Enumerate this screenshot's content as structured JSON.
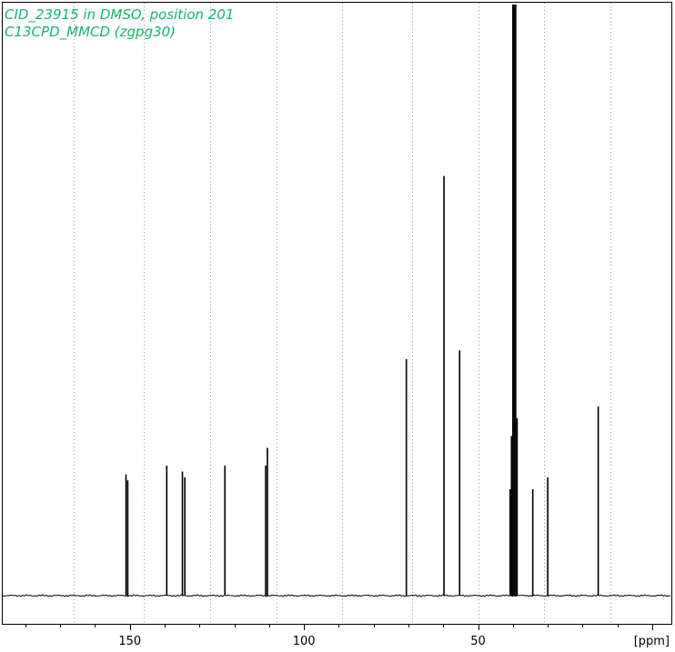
{
  "header": {
    "line1": "CID_23915 in DMSO, position 201",
    "line2": "C13CPD_MMCD (zgpg30)",
    "color": "#19b36b"
  },
  "chart_data": {
    "type": "line",
    "title": "CID_23915 in DMSO, position 201",
    "subtitle": "C13CPD_MMCD (zgpg30)",
    "xlabel": "[ppm]",
    "ylabel": "",
    "xlim": [
      186.5,
      -5.5
    ],
    "x_reversed": true,
    "ylim": [
      0,
      1.0
    ],
    "grid": "vertical-dotted",
    "x_ticks": [
      150,
      100,
      50
    ],
    "x_tick_labels": [
      "150",
      "100",
      "50"
    ],
    "grid_x": [
      166,
      146,
      127,
      108,
      89,
      69,
      50,
      31,
      12
    ],
    "line_color": "#000000",
    "peaks": [
      {
        "x": 151.1,
        "y": 0.205
      },
      {
        "x": 150.6,
        "y": 0.195
      },
      {
        "x": 139.4,
        "y": 0.22
      },
      {
        "x": 134.9,
        "y": 0.21
      },
      {
        "x": 134.2,
        "y": 0.2
      },
      {
        "x": 122.7,
        "y": 0.22
      },
      {
        "x": 111.0,
        "y": 0.22
      },
      {
        "x": 110.5,
        "y": 0.25
      },
      {
        "x": 70.6,
        "y": 0.4
      },
      {
        "x": 59.8,
        "y": 0.71
      },
      {
        "x": 55.3,
        "y": 0.415
      },
      {
        "x": 40.8,
        "y": 0.18
      },
      {
        "x": 40.4,
        "y": 0.27
      },
      {
        "x": 40.0,
        "y": 1.0
      },
      {
        "x": 39.6,
        "y": 1.0
      },
      {
        "x": 39.2,
        "y": 1.0
      },
      {
        "x": 38.8,
        "y": 0.3
      },
      {
        "x": 34.3,
        "y": 0.18
      },
      {
        "x": 30.0,
        "y": 0.2
      },
      {
        "x": 15.5,
        "y": 0.32
      }
    ]
  }
}
